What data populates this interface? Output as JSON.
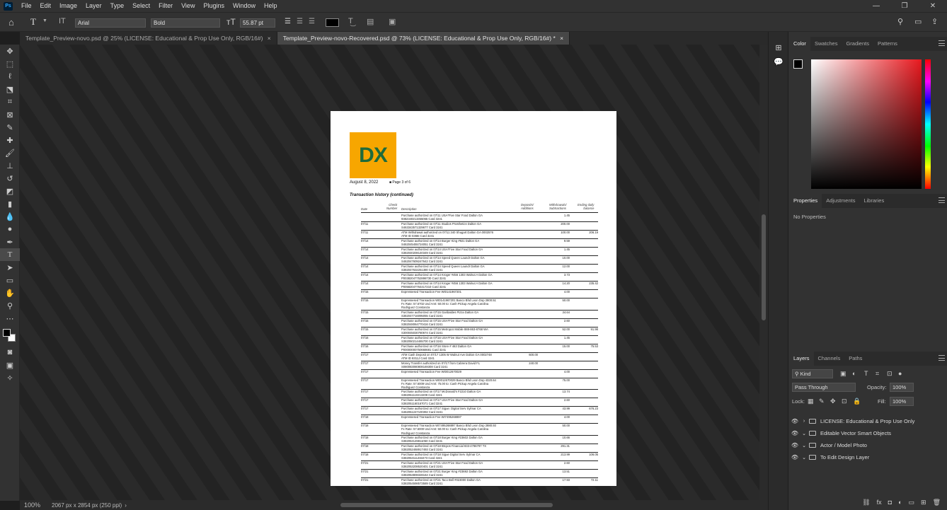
{
  "menu": {
    "logo": "Ps",
    "items": [
      "File",
      "Edit",
      "Image",
      "Layer",
      "Type",
      "Select",
      "Filter",
      "View",
      "Plugins",
      "Window",
      "Help"
    ]
  },
  "window_controls": {
    "minimize": "—",
    "restore": "❐",
    "close": "✕"
  },
  "options": {
    "font_family": "Arial",
    "font_style": "Bold",
    "font_size": "55.87 pt",
    "text_color": "#000000"
  },
  "tabs": [
    {
      "label": "Template_Preview-novo.psd @ 25% (LICENSE: Educational & Prop Use Only, RGB/16#)",
      "close": "×"
    },
    {
      "label": "Template_Preview-novo-Recovered.psd @ 73% (LICENSE: Educational & Prop Use Only, RGB/16#) *",
      "close": "×"
    }
  ],
  "status": {
    "zoom": "100%",
    "dimensions": "2067 px x 2854 px (250 ppi)"
  },
  "doc": {
    "logo_d": "D",
    "logo_x": "X",
    "date": "August 8, 2022",
    "page": "■ Page 3 of 6",
    "heading": "Transaction history (continued)",
    "headers": {
      "date": "Date",
      "check": "Check\nNumber",
      "desc": "Description",
      "dep": "Deposits/\nAdditions",
      "wd": "Withdrawals/\nSubtractions",
      "bal": "Ending daily\nbalance"
    },
    "rows": [
      {
        "date": "",
        "desc": "Purchase authorized on 07/11 USA*Five Star Food Dalton GA 9382340213355065 Card 3241",
        "dep": "",
        "wd": "1.45",
        "bal": ""
      },
      {
        "date": "07/11",
        "desc": "Purchase authorized on 07/11 Studios Prosthetics Dalton GA S463343571329677 Card 3241",
        "dep": "",
        "wd": "200.00",
        "bal": ""
      },
      {
        "date": "07/11",
        "desc": "ATM Withdrawal authorized on 07/11 340 Shugart Dalton GA 0002576 ATM ID 0366I Card 3241",
        "dep": "",
        "wd": "100.00",
        "bal": "206.19"
      },
      {
        "date": "07/14",
        "desc": "Purchase authorized on 07/14 Burger King #921 Dalton GA S462045455724051 Card 3241",
        "dep": "",
        "wd": "9.59",
        "bal": ""
      },
      {
        "date": "07/14",
        "desc": "Purchase authorized on 07/14 USA*Five Star Food Dalton GA S382040208140349 Card 3241",
        "dep": "",
        "wd": "1.45",
        "bal": ""
      },
      {
        "date": "07/14",
        "desc": "Purchase authorized on 07/14 Speed Queen Laundr Dalton GA S462047609247642 Card 3241",
        "dep": "",
        "wd": "10.00",
        "bal": ""
      },
      {
        "date": "07/14",
        "desc": "Purchase authorized on 07/14 Speed Queen Laundr Dalton GA S382047632251380 Card 3241",
        "dep": "",
        "wd": "12.00",
        "bal": ""
      },
      {
        "date": "07/14",
        "desc": "Purchase authorized on 07/14 Kroger #456 1303 Walnut A Dalton GA P00382047752898730 Card 3241",
        "dep": "",
        "wd": "3.73",
        "bal": ""
      },
      {
        "date": "07/14",
        "desc": "Purchase authorized on 07/14 Kroger #456 1303 Walnut A Dalton GA P00582047764417210 Card 3241",
        "dep": "",
        "wd": "14.20",
        "bal": "235.42"
      },
      {
        "date": "07/15",
        "desc": "Expressesed Transaction Fee Wt0141967201",
        "dep": "",
        "wd": "4.00",
        "bal": ""
      },
      {
        "date": "07/15",
        "desc": "Expressesed Transaction Wt0141967201 Banco Bhd Leon Dop 2800.51 Fx Rate: 57.6702 Usd Amt: 50.00 to: Cash Pickup Angela Carolina Rodriguez Constanza",
        "dep": "",
        "wd": "50.00",
        "bal": ""
      },
      {
        "date": "07/15",
        "desc": "Purchase authorized on 07/15 Garibaldes Pizza Dalton GA S382047716095055 Card 3241",
        "dep": "",
        "wd": "34.64",
        "bal": ""
      },
      {
        "date": "07/15",
        "desc": "Purchase authorized on 07/15 USA*Five Star Food Dalton GA S382048064770416 Card 3241",
        "dep": "",
        "wd": "2.60",
        "bal": ""
      },
      {
        "date": "07/15",
        "desc": "Purchase authorized on 07/15 Metropcs Mobile 888-863-8768 WA S300045030780674 Card 3241",
        "dep": "",
        "wd": "52.00",
        "bal": "91.98"
      },
      {
        "date": "07/16",
        "desc": "Purchase authorized on 07/16 USA*Five Star Food Dalton GA S382050214465700 Card 3241",
        "dep": "",
        "wd": "1.45",
        "bal": ""
      },
      {
        "date": "07/16",
        "desc": "Purchase authorized on 07/16 Store # 463 Dalton GA P00000000750668681 Card 3241",
        "dep": "",
        "wd": "15.00",
        "bal": "75.53"
      },
      {
        "date": "07/17",
        "desc": "ATM Cash Deposit on 07/17 1305 W Walnut Ave Dalton GA 0002748 ATM ID 8311J Card 3241",
        "dep": "600.00",
        "wd": "",
        "bal": ""
      },
      {
        "date": "07/17",
        "desc": "Money Transfer authorized on 07/17 from Cabrera David FL S080083080808169308 Card 3241",
        "dep": "240.00",
        "wd": "",
        "bal": ""
      },
      {
        "date": "07/17",
        "desc": "Expressesed Transaction Fee Wt0012670029",
        "dep": "",
        "wd": "4.00",
        "bal": ""
      },
      {
        "date": "07/17",
        "desc": "Expressesed Transaction Wt0012670029 Banco Bhd Leon Dop 4320.64 Fx Rate: 57.6009 Usd Amt: 75.00 to: Cash Pickup Angela Carolina Rodriguez Constanza",
        "dep": "",
        "wd": "75.00",
        "bal": ""
      },
      {
        "date": "07/17",
        "desc": "Purchase authorized on 07/17 McDonald's F2210 Dalton GA S382051110213209 Card 3241",
        "dep": "",
        "wd": "13.74",
        "bal": ""
      },
      {
        "date": "07/17",
        "desc": "Purchase authorized on 07/17 USA*Five Star Food Dalton GA S382051160167071 Card 3241",
        "dep": "",
        "wd": "2.60",
        "bal": ""
      },
      {
        "date": "07/17",
        "desc": "Purchase authorized on 07/17 Sigue: Digital Serv Sylmar CA S462051247100392 Card 3241",
        "dep": "",
        "wd": "43.99",
        "bal": "676.23"
      },
      {
        "date": "07/18",
        "desc": "Expressesed Transaction Fee Wt7495268897",
        "dep": "",
        "wd": "4.00",
        "bal": ""
      },
      {
        "date": "07/18",
        "desc": "Expressesed Transaction Wt7495268897 Banco Bhd Leon Dop 2880.93 Fx Rate: 57.6000 Usd Amt: 50.00 to: Cash Pickup Angela Carolina Rodriguez Constanza",
        "dep": "",
        "wd": "50.00",
        "bal": ""
      },
      {
        "date": "07/18",
        "desc": "Purchase authorized on 07/18 Burger King #23602 Dalton GA S382053149811050 Card 3241",
        "dep": "",
        "wd": "10.66",
        "bal": ""
      },
      {
        "date": "07/18",
        "desc": "Purchase authorized on 07/18 Btcpos Financial 833-4786797 TX S382052468917493 Card 3241",
        "dep": "",
        "wd": "291.31",
        "bal": ""
      },
      {
        "date": "07/18",
        "desc": "Purchase authorized on 07/18 Sigue Digital Serv Sylmar CA S382053111463473 Card 3241",
        "dep": "",
        "wd": "213.99",
        "bal": "106.05"
      },
      {
        "date": "07/21",
        "desc": "Purchase authorized on 07/21 USA*Five Star Food Dalton GA S382053208520401 Card 3241",
        "dep": "",
        "wd": "2.60",
        "bal": ""
      },
      {
        "date": "07/21",
        "desc": "Purchase authorized on 07/21 Burger King #23692 Dalton GA S382053808328164 Card 3241",
        "dep": "",
        "wd": "13.51",
        "bal": ""
      },
      {
        "date": "07/21",
        "desc": "Purchase authorized on 07/21 Taco Bell #023000 Dalton GA S382054598573589 Card 3241",
        "dep": "",
        "wd": "17.93",
        "bal": "72.11"
      }
    ]
  },
  "panels": {
    "color_tabs": [
      "Color",
      "Swatches",
      "Gradients",
      "Patterns"
    ],
    "prop_tabs": [
      "Properties",
      "Adjustments",
      "Libraries"
    ],
    "no_properties": "No Properties",
    "layer_tabs": [
      "Layers",
      "Channels",
      "Paths"
    ],
    "kind": "Kind",
    "blend_mode": "Pass Through",
    "opacity_label": "Opacity:",
    "opacity": "100%",
    "lock_label": "Lock:",
    "fill_label": "Fill:",
    "fill": "100%",
    "layers": [
      {
        "name": "LICENSE: Educational & Prop Use Only",
        "expanded": false
      },
      {
        "name": "Editable Vector Smart Objects",
        "expanded": true
      },
      {
        "name": "Actor / Model Photo",
        "expanded": true
      },
      {
        "name": "To Edit Design Layer",
        "expanded": true
      }
    ]
  }
}
